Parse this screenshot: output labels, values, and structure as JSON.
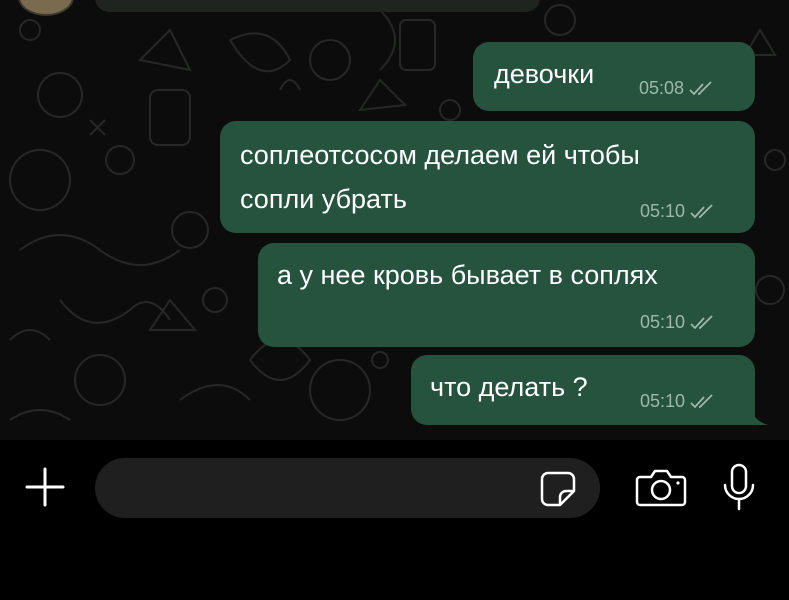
{
  "messages": [
    {
      "text": "девочки",
      "time": "05:08",
      "status": "read"
    },
    {
      "text_line1": "соплеотсосом делаем ей чтобы",
      "text_line2": "сопли убрать",
      "time": "05:10",
      "status": "read"
    },
    {
      "text": "а у нее кровь бывает в соплях",
      "time": "05:10",
      "status": "read"
    },
    {
      "text": "что делать ?",
      "time": "05:10",
      "status": "read"
    }
  ],
  "composer": {
    "placeholder": "",
    "value": "",
    "icons": [
      "plus-icon",
      "sticker-icon",
      "camera-icon",
      "microphone-icon"
    ]
  },
  "colors": {
    "outgoing_bubble": "#25533e",
    "chat_background": "#0b0c0b",
    "timestamp": "#9fb8ab",
    "input_background": "#1f1f1f"
  }
}
